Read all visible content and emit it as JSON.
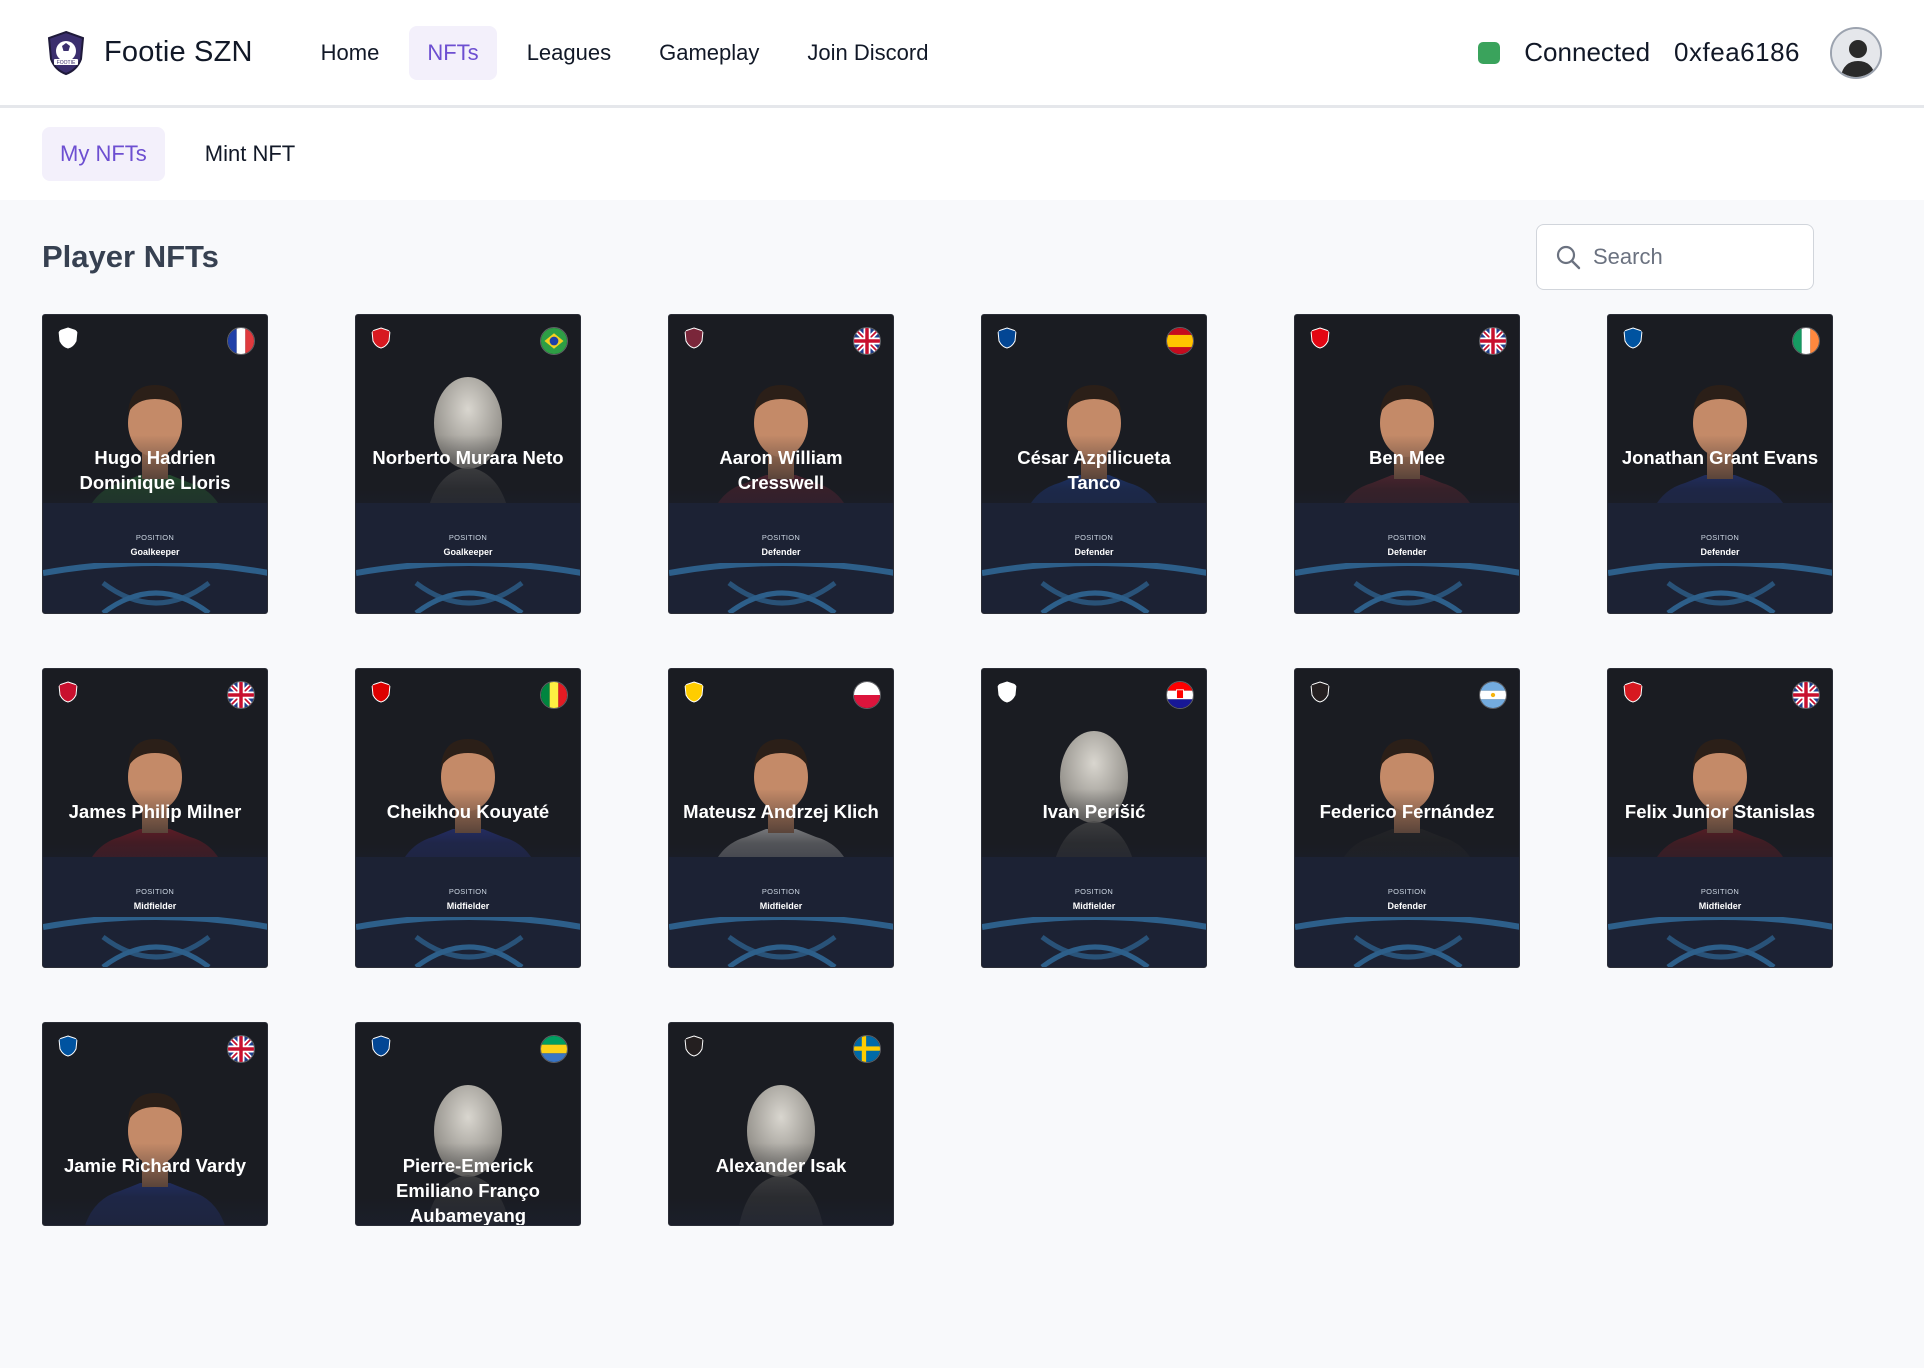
{
  "app": {
    "name": "Footie SZN"
  },
  "nav": [
    {
      "label": "Home",
      "active": false
    },
    {
      "label": "NFTs",
      "active": true
    },
    {
      "label": "Leagues",
      "active": false
    },
    {
      "label": "Gameplay",
      "active": false
    },
    {
      "label": "Join Discord",
      "active": false
    }
  ],
  "wallet": {
    "status": "Connected",
    "address": "0xfea6186",
    "status_color": "#3aa35c"
  },
  "subtabs": [
    {
      "label": "My NFTs",
      "active": true
    },
    {
      "label": "Mint NFT",
      "active": false
    }
  ],
  "page": {
    "title": "Player NFTs"
  },
  "search": {
    "placeholder": "Search",
    "value": ""
  },
  "position_label": "POSITION",
  "cards": [
    {
      "name": "Hugo Hadrien Dominique Lloris",
      "position": "Goalkeeper",
      "club_icon": "tottenham-crest-icon",
      "flag": "france-flag-icon",
      "has_photo": true,
      "shirt": "#2f7d3c"
    },
    {
      "name": "Norberto Murara Neto",
      "position": "Goalkeeper",
      "club_icon": "bournemouth-crest-icon",
      "flag": "brazil-flag-icon",
      "has_photo": false,
      "shirt": "#7a7a7a"
    },
    {
      "name": "Aaron William Cresswell",
      "position": "Defender",
      "club_icon": "west-ham-crest-icon",
      "flag": "uk-flag-icon",
      "has_photo": true,
      "shirt": "#7b2a3d"
    },
    {
      "name": "César Azpilicueta Tanco",
      "position": "Defender",
      "club_icon": "chelsea-crest-icon",
      "flag": "spain-flag-icon",
      "has_photo": true,
      "shirt": "#1f47a8"
    },
    {
      "name": "Ben Mee",
      "position": "Defender",
      "club_icon": "brentford-crest-icon",
      "flag": "uk-flag-icon",
      "has_photo": true,
      "shirt": "#7a2d3a"
    },
    {
      "name": "Jonathan Grant Evans",
      "position": "Defender",
      "club_icon": "leicester-crest-icon",
      "flag": "ireland-flag-icon",
      "has_photo": true,
      "shirt": "#283f9c"
    },
    {
      "name": "James Philip Milner",
      "position": "Midfielder",
      "club_icon": "liverpool-crest-icon",
      "flag": "uk-flag-icon",
      "has_photo": true,
      "shirt": "#a01d2a"
    },
    {
      "name": "Cheikhou Kouyaté",
      "position": "Midfielder",
      "club_icon": "nottingham-forest-crest-icon",
      "flag": "senegal-flag-icon",
      "has_photo": true,
      "shirt": "#2c3da3"
    },
    {
      "name": "Mateusz Andrzej Klich",
      "position": "Midfielder",
      "club_icon": "leeds-crest-icon",
      "flag": "poland-flag-icon",
      "has_photo": true,
      "shirt": "#d8d8d8"
    },
    {
      "name": "Ivan Perišić",
      "position": "Midfielder",
      "club_icon": "tottenham-crest-icon",
      "flag": "croatia-flag-icon",
      "has_photo": false,
      "shirt": "#7a7a7a"
    },
    {
      "name": "Federico Fernández",
      "position": "Defender",
      "club_icon": "newcastle-crest-icon",
      "flag": "argentina-flag-icon",
      "has_photo": true,
      "shirt": "#2b2b2b"
    },
    {
      "name": "Felix Junior Stanislas",
      "position": "Midfielder",
      "club_icon": "bournemouth-crest-icon",
      "flag": "uk-flag-icon",
      "has_photo": true,
      "shirt": "#8f1f28"
    },
    {
      "name": "Jamie Richard Vardy",
      "position": "",
      "club_icon": "leicester-crest-icon",
      "flag": "uk-flag-icon",
      "has_photo": true,
      "shirt": "#283f9c"
    },
    {
      "name": "Pierre-Emerick Emiliano Franço Aubameyang",
      "position": "",
      "club_icon": "chelsea-crest-icon",
      "flag": "gabon-flag-icon",
      "has_photo": false,
      "shirt": "#7a7a7a"
    },
    {
      "name": "Alexander Isak",
      "position": "",
      "club_icon": "newcastle-crest-icon",
      "flag": "sweden-flag-icon",
      "has_photo": false,
      "shirt": "#7a7a7a"
    }
  ],
  "colors": {
    "accent": "#6d4fd1",
    "accent_bg": "#f3f0fb",
    "card_bg": "#1a1c22",
    "card_lower": "#1c2234",
    "arc": "#2d5f8a"
  }
}
